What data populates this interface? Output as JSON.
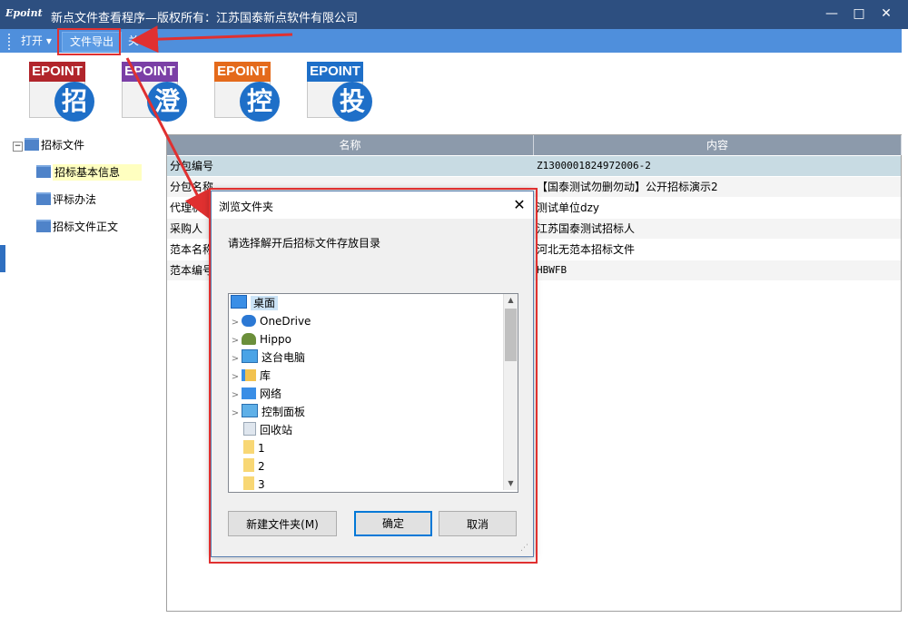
{
  "window": {
    "logo": "Epoint",
    "title": "新点文件查看程序—版权所有：江苏国泰新点软件有限公司",
    "minimize": "—",
    "maximize": "□",
    "close": "✕"
  },
  "menu": {
    "open": "打开 ▾",
    "export": "文件导出",
    "about": "关于"
  },
  "icons": [
    {
      "brand": "EPOINT",
      "char": "招",
      "band_color": "#b1252b"
    },
    {
      "brand": "EPOINT",
      "char": "澄",
      "band_color": "#7b3fa6"
    },
    {
      "brand": "EPOINT",
      "char": "控",
      "band_color": "#e46a1b"
    },
    {
      "brand": "EPOINT",
      "char": "投",
      "band_color": "#1e6fc8"
    }
  ],
  "tree": {
    "root": "招标文件",
    "children": [
      "招标基本信息",
      "评标办法",
      "招标文件正文"
    ]
  },
  "grid": {
    "headers": [
      "名称",
      "内容"
    ],
    "rows": [
      [
        "分包编号",
        "Z1300001824972006-2"
      ],
      [
        "分包名称",
        "【国泰测试勿删勿动】公开招标演示2"
      ],
      [
        "代理机构",
        "测试单位dzy"
      ],
      [
        "采购人",
        "江苏国泰测试招标人"
      ],
      [
        "范本名称",
        "河北无范本招标文件"
      ],
      [
        "范本编号",
        "HBWFB"
      ]
    ]
  },
  "dialog": {
    "title": "浏览文件夹",
    "close": "✕",
    "prompt": "请选择解开后招标文件存放目录",
    "folders": [
      {
        "label": "桌面",
        "icon": "desktop-icon",
        "expand": false,
        "selected": true
      },
      {
        "label": "OneDrive",
        "icon": "cloud-icon",
        "expand": true,
        "selected": false
      },
      {
        "label": "Hippo",
        "icon": "user-icon",
        "expand": true,
        "selected": false
      },
      {
        "label": "这台电脑",
        "icon": "computer-icon",
        "expand": true,
        "selected": false
      },
      {
        "label": "库",
        "icon": "library-icon",
        "expand": true,
        "selected": false
      },
      {
        "label": "网络",
        "icon": "network-icon",
        "expand": true,
        "selected": false
      },
      {
        "label": "控制面板",
        "icon": "control-panel-icon",
        "expand": true,
        "selected": false
      },
      {
        "label": "回收站",
        "icon": "recycle-bin-icon",
        "expand": false,
        "selected": false
      },
      {
        "label": "1",
        "icon": "folder-icon",
        "expand": false,
        "selected": false
      },
      {
        "label": "2",
        "icon": "folder-icon",
        "expand": false,
        "selected": false
      },
      {
        "label": "3",
        "icon": "folder-icon",
        "expand": false,
        "selected": false
      }
    ],
    "new_folder": "新建文件夹(M)",
    "ok": "确定",
    "cancel": "取消"
  },
  "colors": {
    "titlebar": "#2d4f80",
    "toolbar": "#4f8fdc",
    "grid_header": "#8c9aab",
    "selected_row": "#c8dbe3",
    "annotation": "#e03030"
  }
}
